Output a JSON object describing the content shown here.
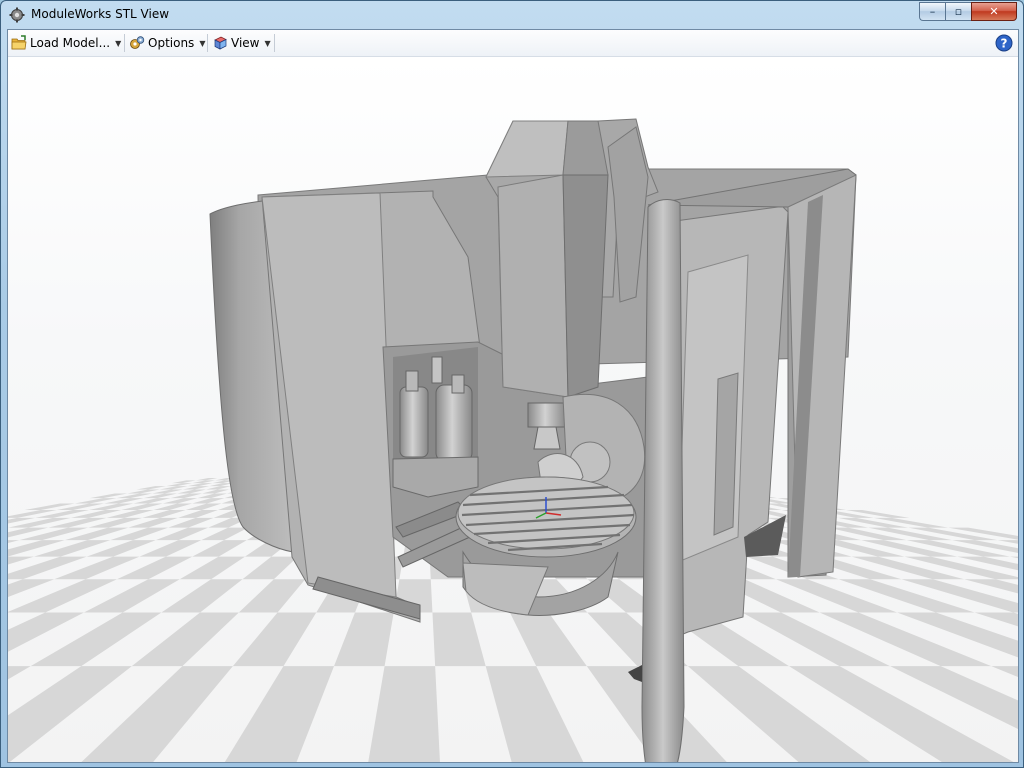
{
  "window": {
    "title": "ModuleWorks STL View",
    "minimize_glyph": "–",
    "maximize_glyph": "▫",
    "close_glyph": "✕"
  },
  "toolbar": {
    "load_model_label": "Load Model...",
    "options_label": "Options",
    "view_label": "View",
    "dropdown_glyph": "▼",
    "help_glyph": "?"
  },
  "icons": {
    "app": "gear-icon",
    "load_model": "folder-icon",
    "options": "gears-icon",
    "view": "cube-view-icon",
    "help": "help-icon"
  },
  "colors": {
    "titlebar": "#a9cbe6",
    "model_gray": "#9a9a9a",
    "floor_tile": "#d7d7d7",
    "help_blue": "#2e64c8"
  }
}
